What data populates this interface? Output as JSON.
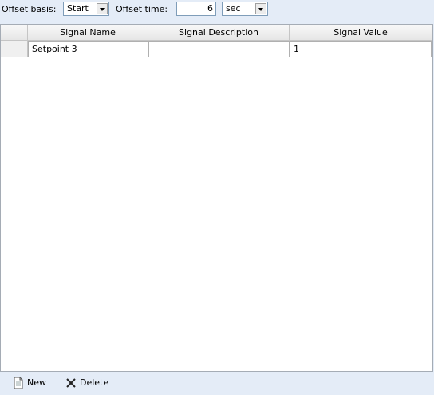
{
  "toolbar": {
    "offset_basis_label": "Offset basis:",
    "offset_basis_value": "Start",
    "offset_time_label": "Offset time:",
    "offset_time_value": "6",
    "offset_unit_value": "sec"
  },
  "grid": {
    "columns": [
      "Signal Name",
      "Signal Description",
      "Signal Value"
    ],
    "rows": [
      {
        "name": "Setpoint 3",
        "description": "",
        "value": "1"
      }
    ]
  },
  "actions": {
    "new_label": "New",
    "delete_label": "Delete"
  },
  "colors": {
    "background": "#e4ecf7",
    "input_border": "#7f9db9",
    "grid_border": "#a5acb5"
  }
}
